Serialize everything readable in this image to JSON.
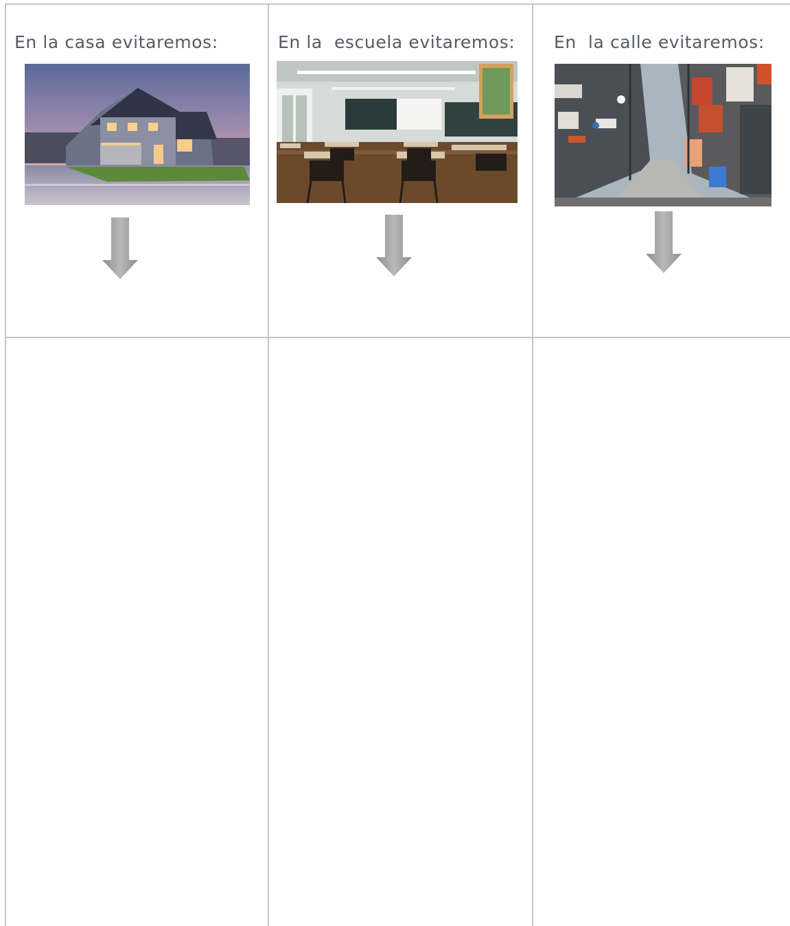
{
  "columns": [
    {
      "heading": "En la casa evitaremos:",
      "image": "house-photo",
      "answer": ""
    },
    {
      "heading": "En la  escuela evitaremos:",
      "image": "classroom-photo",
      "answer": ""
    },
    {
      "heading": "En  la calle evitaremos:",
      "image": "street-photo",
      "answer": ""
    }
  ],
  "icons": {
    "arrow": "down-arrow-icon"
  },
  "colors": {
    "border": "#c4c4c4",
    "text": "#555a63",
    "arrow": "#9a9a9a"
  }
}
